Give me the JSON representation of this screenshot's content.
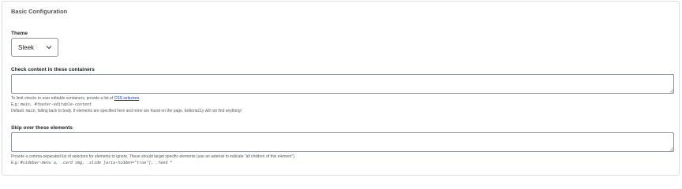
{
  "section_title": "Basic Configuration",
  "theme": {
    "label": "Theme",
    "selected": "Sleek"
  },
  "check_containers": {
    "label": "Check content in these containers",
    "value": "",
    "desc_prefix": "To limit checks to user-editable containers, provide a list of ",
    "desc_link": "CSS selectors",
    "desc_suffix": ".",
    "eg_prefix": "E.g.: ",
    "eg_code": "main, #footer-editable-content",
    "default_prefix": "Default: ",
    "default_code": "main",
    "default_suffix": ", falling back to body. If elements are specified here and none are found on the page, Editoria11y will not find anything!"
  },
  "skip_elements": {
    "label": "Skip over these elements",
    "value": "",
    "desc": "Provide a comma-separated list of selectors for elements to ignore. These should target specific elements (use an asterisk to indicate \"all children of this element\").",
    "eg_prefix": "E.g.: ",
    "eg_code": "#sidebar-menu a, .card img, .slide [aria-hidden=\"true\"], .feed *"
  },
  "icons": {
    "select": "chevron-down-icon",
    "textarea": "resize-grip-icon"
  }
}
